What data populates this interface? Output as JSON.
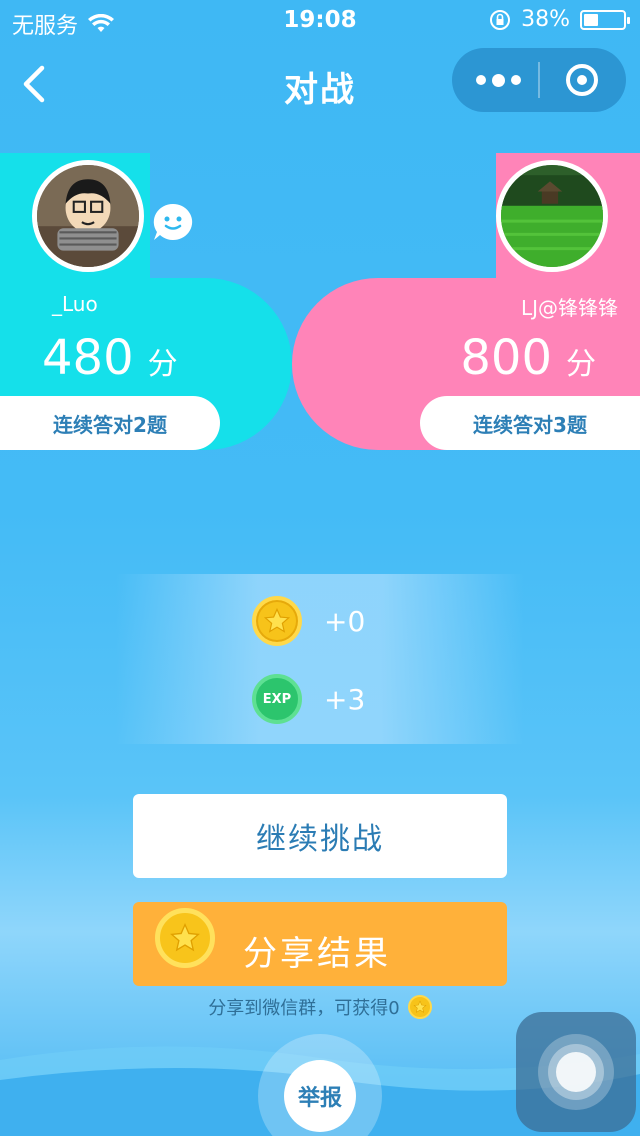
{
  "status_bar": {
    "carrier": "无服务",
    "time": "19:08",
    "battery": "38%",
    "battery_level": 0.38
  },
  "nav": {
    "title": "对战"
  },
  "players": {
    "left": {
      "name": "_Luo",
      "score": "480",
      "score_unit": "分",
      "streak": "连续答对2题",
      "color": "#15e0ea"
    },
    "right": {
      "name": "LJ@锋锋锋",
      "score": "800",
      "score_unit": "分",
      "streak": "连续答对3题",
      "color": "#ff84b8"
    }
  },
  "rewards": {
    "coins": "+0",
    "exp_badge": "EXP",
    "exp": "+3"
  },
  "buttons": {
    "continue": "继续挑战",
    "share": "分享结果",
    "share_hint": "分享到微信群，可获得0",
    "report": "举报"
  },
  "icons": {
    "back": "chevron-left-icon",
    "more": "more-dots-icon",
    "close": "target-icon",
    "chat": "chat-bubble-icon",
    "coin": "star-coin-icon",
    "exp": "exp-badge-icon"
  }
}
